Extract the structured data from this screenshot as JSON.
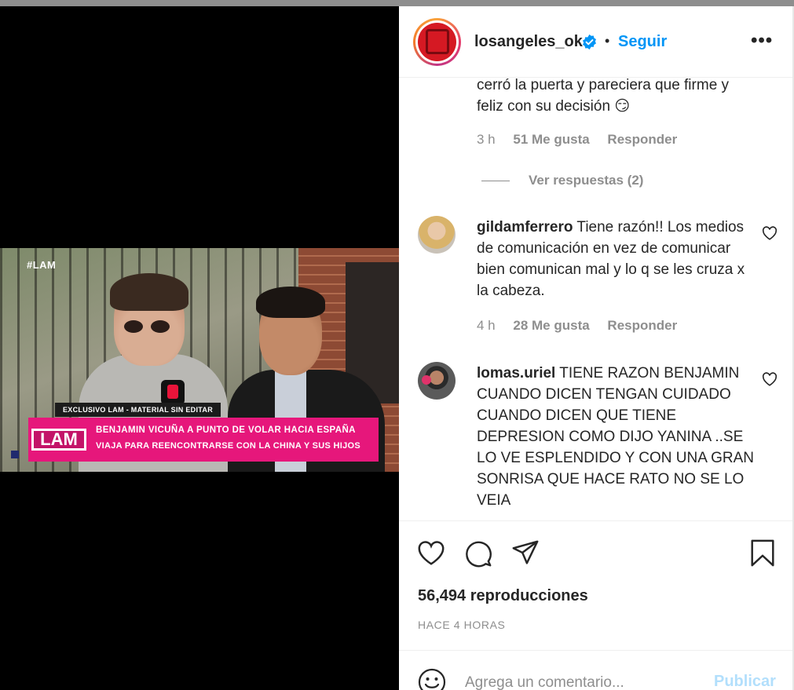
{
  "video": {
    "hashtag": "#LAM",
    "exclusive_label": "EXCLUSIVO LAM - MATERIAL SIN EDITAR",
    "banner_logo": "LAM",
    "banner_headline": "BENJAMIN VICUÑA A PUNTO DE VOLAR HACIA ESPAÑA",
    "banner_subline": "VIAJA PARA REENCONTRARSE CON LA CHINA Y SUS HIJOS"
  },
  "header": {
    "username": "losangeles_ok",
    "separator": "•",
    "follow_label": "Seguir",
    "more_label": "•••"
  },
  "comments": {
    "continued": {
      "text": "cerró la puerta y pareciera que firme y feliz con su decisión 😏",
      "time": "3 h",
      "likes": "51 Me gusta",
      "reply_label": "Responder"
    },
    "view_replies": "Ver respuestas (2)",
    "items": [
      {
        "user": "gildamferrero",
        "text": "Tiene razón!! Los medios de comunicación en vez de comunicar bien comunican mal y lo q se les cruza x la cabeza.",
        "time": "4 h",
        "likes": "28 Me gusta",
        "reply_label": "Responder"
      },
      {
        "user": "lomas.uriel",
        "text": "TIENE RAZON BENJAMIN CUANDO DICEN TENGAN CUIDADO CUANDO DICEN QUE TIENE DEPRESION COMO DIJO YANINA ..SE LO VE ESPLENDIDO Y CON UNA GRAN SONRISA QUE HACE RATO NO SE LO VEIA"
      }
    ]
  },
  "actions": {
    "views": "56,494 reproducciones",
    "time_ago": "HACE 4 HORAS"
  },
  "comment_box": {
    "placeholder": "Agrega un comentario...",
    "publish_label": "Publicar"
  },
  "colors": {
    "accent": "#0095f6",
    "muted_text": "#8e8e8e",
    "banner_pink": "#e6177b"
  }
}
